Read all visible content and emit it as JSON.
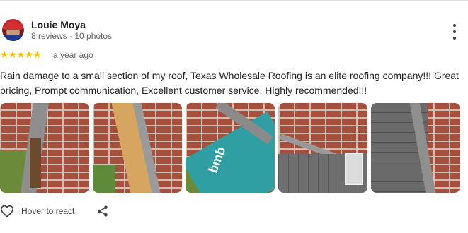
{
  "review": {
    "author": "Louie Moya",
    "author_meta": "8 reviews · 10 photos",
    "rating": 5,
    "rating_max": 5,
    "stars_text": "★★★★★",
    "time_ago": "a year ago",
    "text": "Rain damage to a small section of my roof, Texas Wholesale Roofing is an elite roofing company!!! Great pricing, Prompt communication, Excellent customer service, Highly recommended!!!",
    "photo_count_shown": 5,
    "photo_overlay_text": "bmb"
  },
  "actions": {
    "react_label": "Hover to react"
  },
  "icons": {
    "more": "more-vert-icon",
    "react": "heart-icon",
    "share": "share-icon"
  },
  "colors": {
    "star": "#fbbc04",
    "text": "#202124",
    "secondary": "#5f6368"
  }
}
